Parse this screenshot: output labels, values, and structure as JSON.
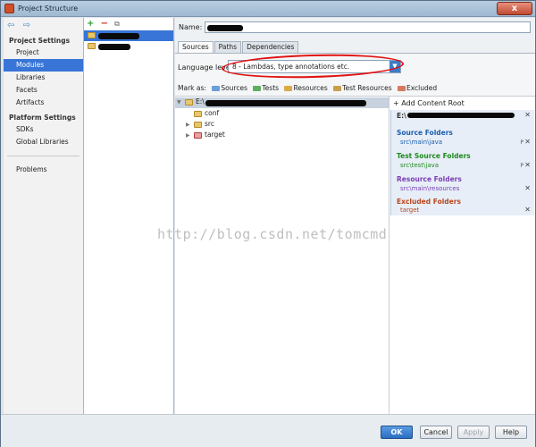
{
  "window": {
    "title": "Project Structure",
    "close_label": "x"
  },
  "sidebar": {
    "nav": {
      "back": "⇦",
      "forward": "⇨"
    },
    "project_settings_header": "Project Settings",
    "project_items": [
      {
        "label": "Project"
      },
      {
        "label": "Modules"
      },
      {
        "label": "Libraries"
      },
      {
        "label": "Facets"
      },
      {
        "label": "Artifacts"
      }
    ],
    "platform_settings_header": "Platform Settings",
    "platform_items": [
      {
        "label": "SDKs"
      },
      {
        "label": "Global Libraries"
      }
    ],
    "other_items": [
      {
        "label": "Problems"
      }
    ]
  },
  "modules_panel": {
    "toolbar": {
      "add": "+",
      "remove": "−",
      "copy": "⧉"
    }
  },
  "content": {
    "name_label": "Name:",
    "name_value": "",
    "tabs": [
      {
        "label": "Sources"
      },
      {
        "label": "Paths"
      },
      {
        "label": "Dependencies"
      }
    ],
    "language_level_label": "Language level:",
    "language_level_value": "8 - Lambdas, type annotations etc.",
    "mark_as_label": "Mark as:",
    "mark_as": [
      {
        "label": "Sources",
        "color": "#6a9ed8"
      },
      {
        "label": "Tests",
        "color": "#5fae5f"
      },
      {
        "label": "Resources",
        "color": "#d9a94a"
      },
      {
        "label": "Test Resources",
        "color": "#c9a04a"
      },
      {
        "label": "Excluded",
        "color": "#d77a5e"
      }
    ],
    "tree": {
      "root_prefix": "E:\\",
      "children": [
        {
          "label": "conf",
          "expandable": false
        },
        {
          "label": "src",
          "expandable": true
        },
        {
          "label": "target",
          "expandable": true
        }
      ]
    },
    "content_root": {
      "add_label": "Add Content Root",
      "path_prefix": "E:\\",
      "groups": [
        {
          "title": "Source Folders",
          "path": "src\\main\\java",
          "color": "#1c5fb0"
        },
        {
          "title": "Test Source Folders",
          "path": "src\\test\\java",
          "color": "#208a20"
        },
        {
          "title": "Resource Folders",
          "path": "src\\main\\resources",
          "color": "#7a3fb5"
        },
        {
          "title": "Excluded Folders",
          "path": "target",
          "color": "#b8471f"
        }
      ]
    }
  },
  "watermark": "http://blog.csdn.net/tomcmd",
  "buttons": {
    "ok": "OK",
    "cancel": "Cancel",
    "apply": "Apply",
    "help": "Help"
  }
}
